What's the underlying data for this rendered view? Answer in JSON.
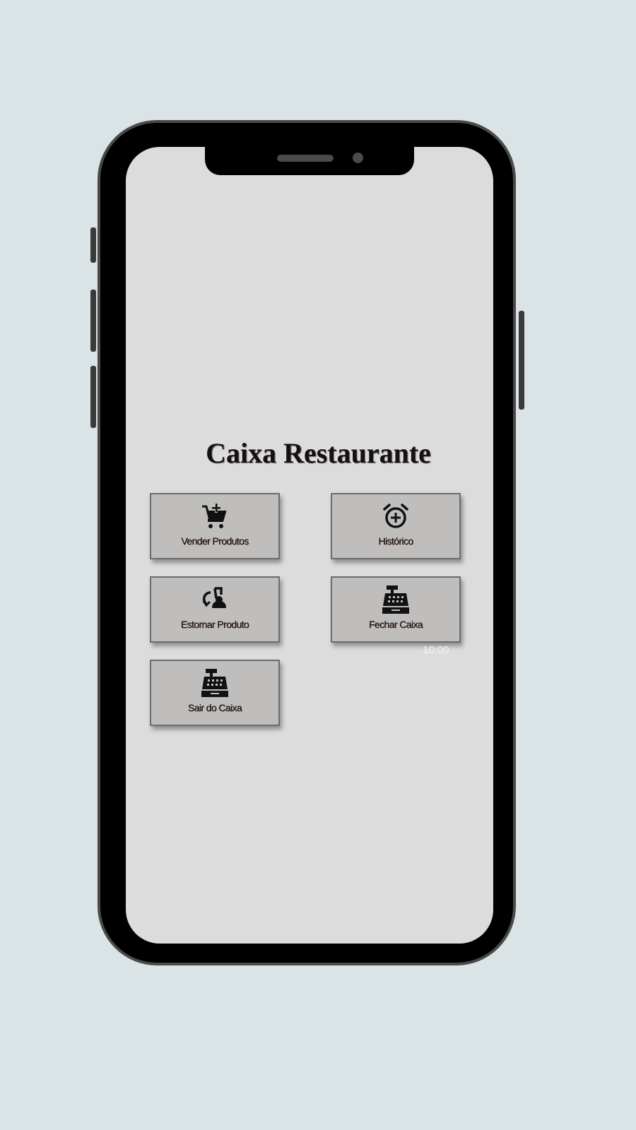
{
  "app": {
    "title": "Caixa Restaurante"
  },
  "menu": {
    "buttons": [
      {
        "label": "Vender Produtos",
        "icon": "cart-plus-icon"
      },
      {
        "label": "Histórico",
        "icon": "alarm-add-icon"
      },
      {
        "label": "Estornar Produto",
        "icon": "refund-icon"
      },
      {
        "label": "Fechar Caixa",
        "icon": "cash-register-icon"
      },
      {
        "label": "Sair do Caixa",
        "icon": "cash-register-icon"
      }
    ]
  },
  "status": {
    "time": "10:00"
  },
  "colors": {
    "background": "#dae3e6",
    "screen": "#dcdcdc",
    "tile": "#c0bebc",
    "frame": "#000000"
  }
}
